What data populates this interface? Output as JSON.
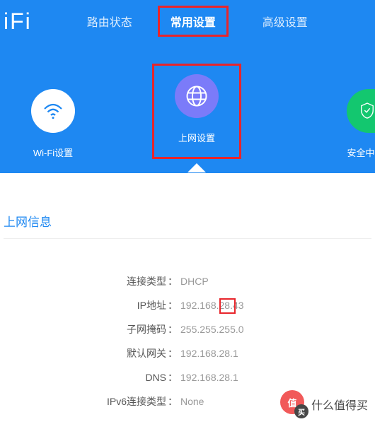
{
  "logo": "iFi",
  "nav": {
    "status": "路由状态",
    "common": "常用设置",
    "advanced": "高级设置"
  },
  "cards": {
    "wifi": "Wi-Fi设置",
    "net": "上网设置",
    "security": "安全中"
  },
  "section_title": "上网信息",
  "info": {
    "conn_type_label": "连接类型",
    "conn_type_value": "DHCP",
    "ip_label": "IP地址",
    "ip_value": "192.168.28.43",
    "mask_label": "子网掩码",
    "mask_value": "255.255.255.0",
    "gw_label": "默认网关",
    "gw_value": "192.168.28.1",
    "dns_label": "DNS",
    "dns_value": "192.168.28.1",
    "ipv6_label": "IPv6连接类型",
    "ipv6_value": "None"
  },
  "watermark": {
    "char1": "值",
    "char2": "买",
    "text": "什么值得买"
  }
}
